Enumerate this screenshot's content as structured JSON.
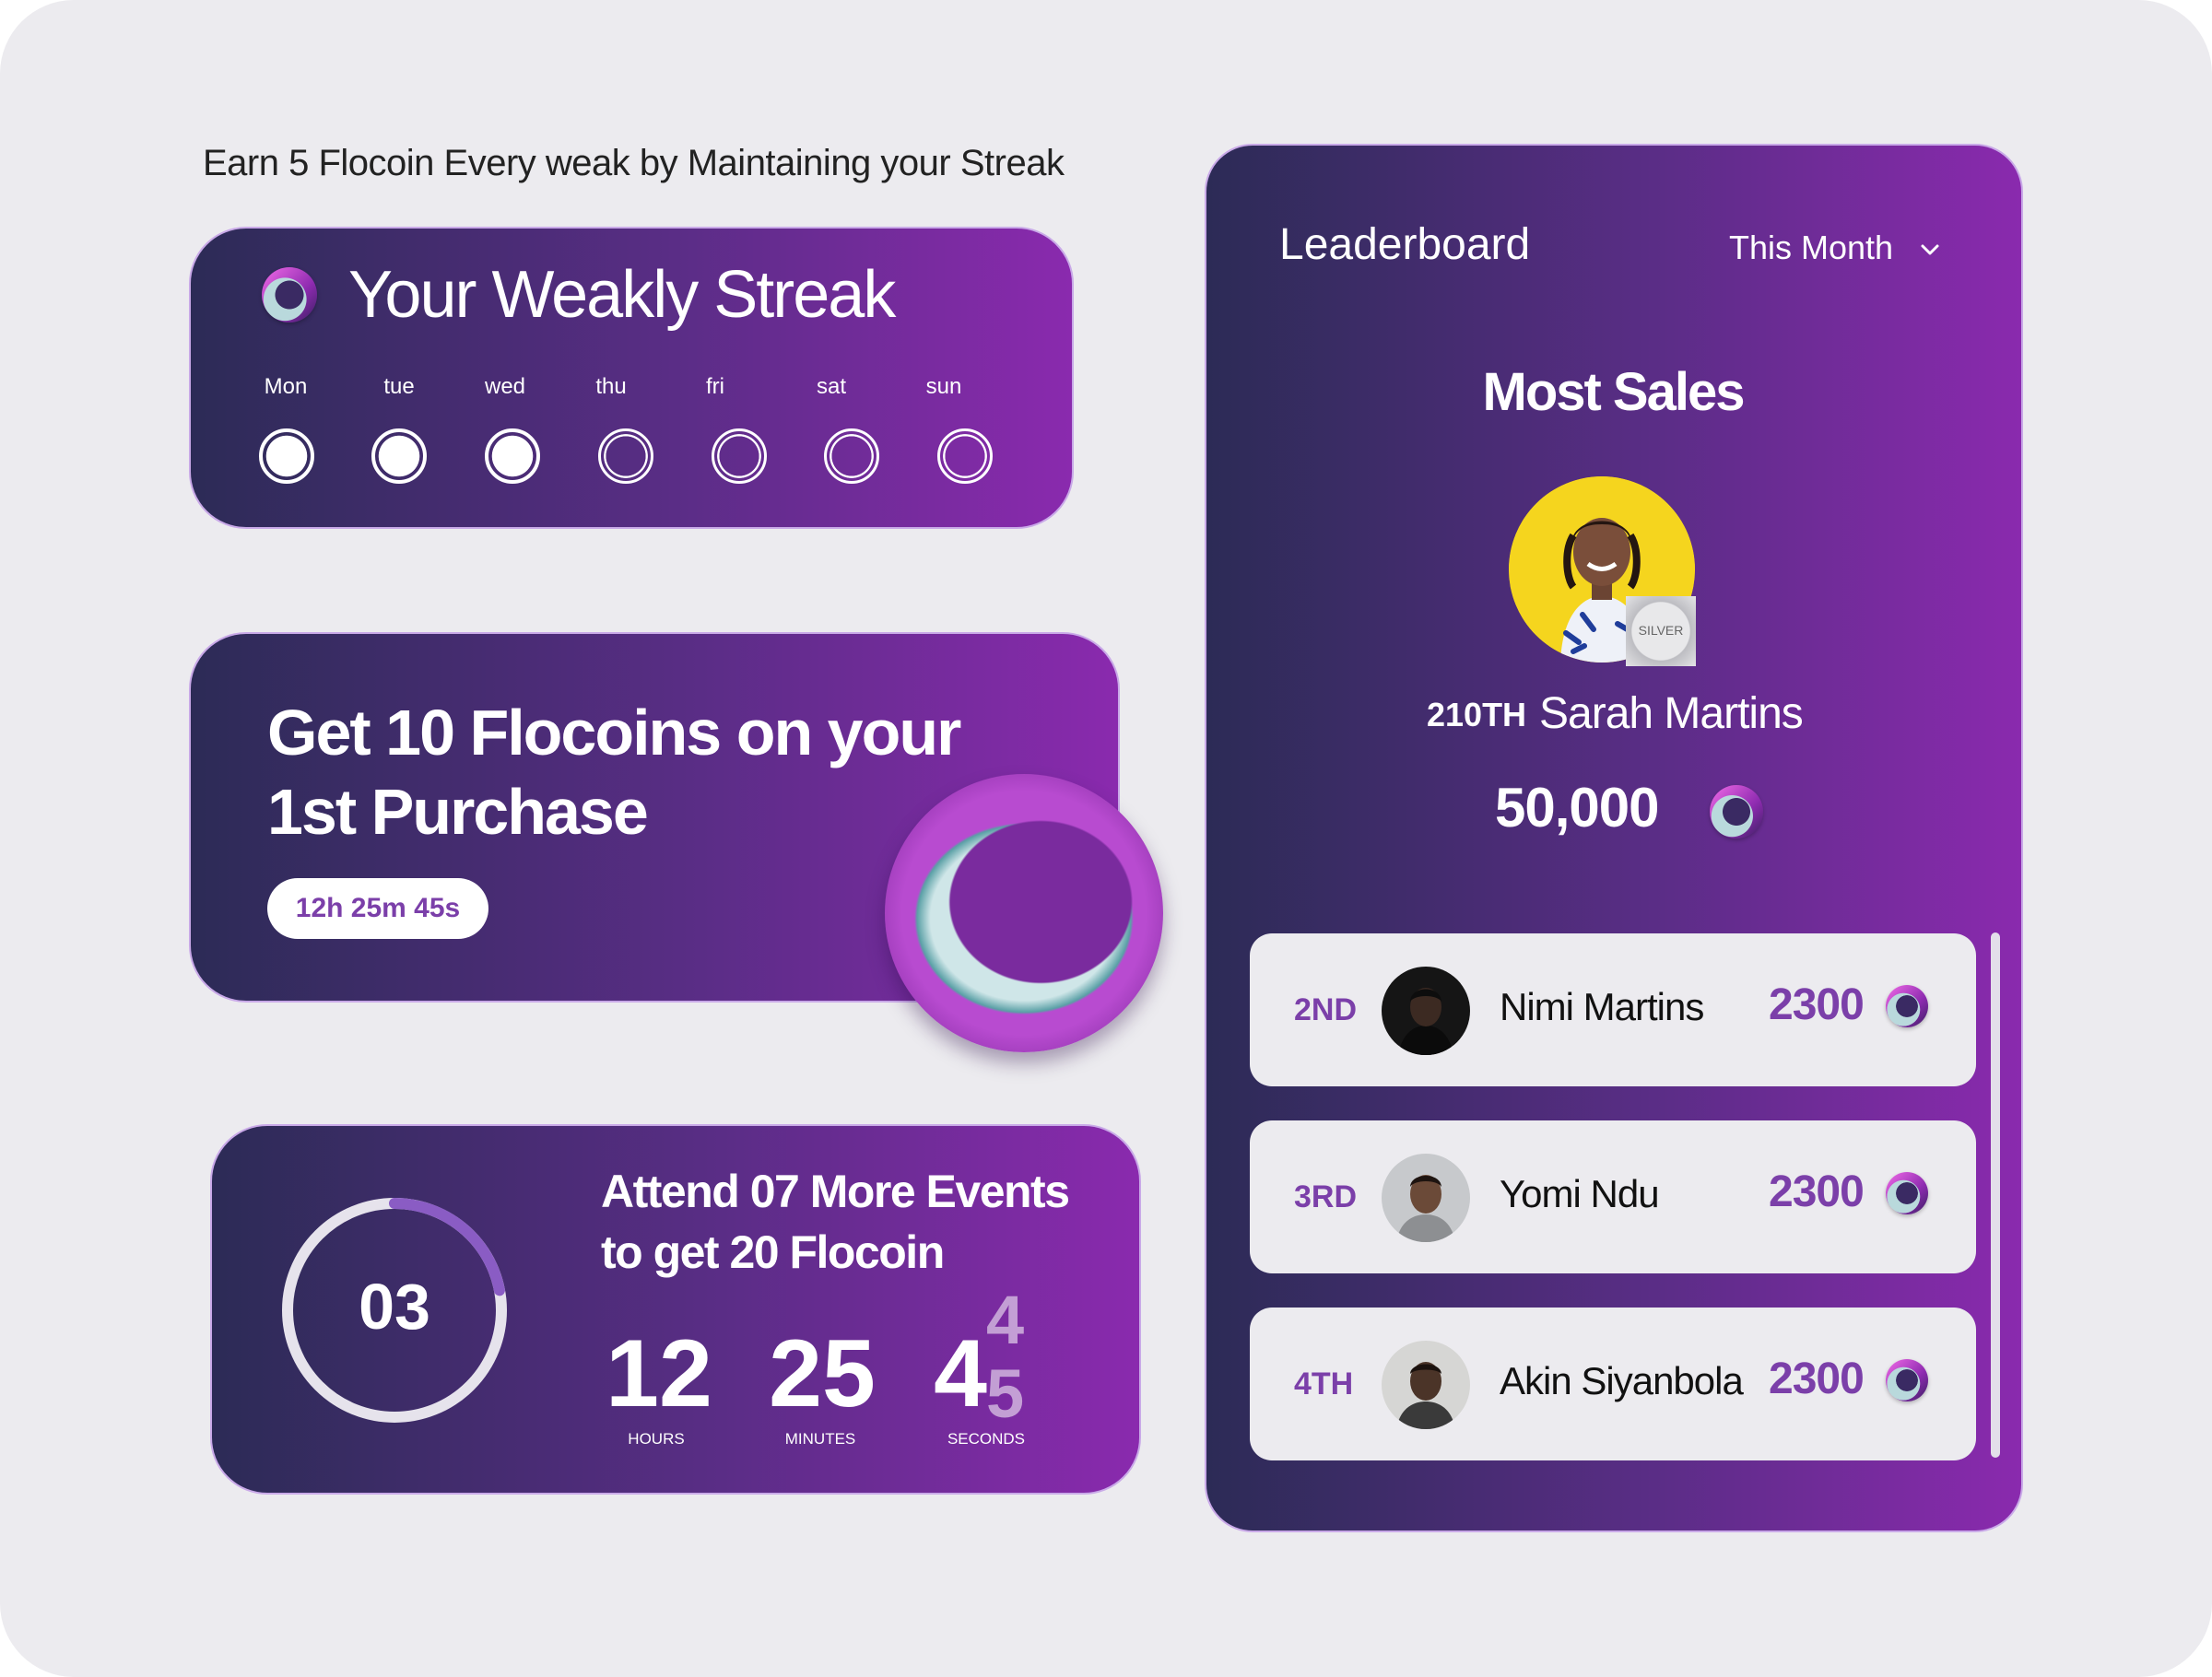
{
  "headline": "Earn 5 Flocoin Every weak by Maintaining your Streak",
  "streak": {
    "title": "Your Weakly Streak",
    "days": [
      {
        "label": "Mon",
        "done": true
      },
      {
        "label": "tue",
        "done": true
      },
      {
        "label": "wed",
        "done": true
      },
      {
        "label": "thu",
        "done": false
      },
      {
        "label": "fri",
        "done": false
      },
      {
        "label": "sat",
        "done": false
      },
      {
        "label": "sun",
        "done": false
      }
    ],
    "icon": "flocoin-icon"
  },
  "purchase": {
    "title": "Get 10 Flocoins on your 1st Purchase",
    "timer": "12h 25m 45s",
    "icon": "flocoin-3d-icon"
  },
  "events": {
    "progress_value": "03",
    "progress_fraction": 0.22,
    "title": "Attend 07 More Events to get 20 Flocoin",
    "countdown": {
      "hours": "12",
      "hours_label": "HOURS",
      "minutes": "25",
      "minutes_label": "MINUTES",
      "seconds_digit": "4",
      "seconds_next_top": "4",
      "seconds_next_bottom": "5",
      "seconds_label": "SECONDS"
    }
  },
  "leaderboard": {
    "title": "Leaderboard",
    "filter": "This Month",
    "heading": "Most Sales",
    "top": {
      "rank": "210TH",
      "name": "Sarah Martins",
      "score": "50,000",
      "badge": "SILVER"
    },
    "rows": [
      {
        "rank": "2ND",
        "name": "Nimi Martins",
        "score": "2300"
      },
      {
        "rank": "3RD",
        "name": "Yomi Ndu",
        "score": "2300"
      },
      {
        "rank": "4TH",
        "name": "Akin Siyanbola",
        "score": "2300"
      }
    ]
  },
  "colors": {
    "gradient_start": "#2c2b56",
    "gradient_end": "#8a2aae",
    "accent": "#7b3fa9",
    "background": "#ecebef"
  }
}
